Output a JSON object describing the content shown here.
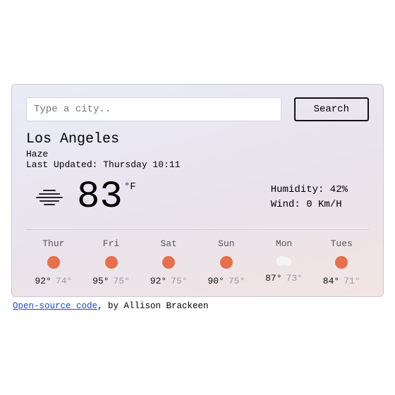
{
  "search": {
    "placeholder": "Type a city..",
    "button": "Search"
  },
  "location": {
    "city": "Los Angeles",
    "condition": "Haze",
    "updated": "Last Updated: Thursday 10:11"
  },
  "current": {
    "temp": "83",
    "unit": "°F",
    "humidity": "Humidity: 42%",
    "wind": "Wind: 0 Km/H"
  },
  "forecast": [
    {
      "day": "Thur",
      "icon": "sun",
      "hi": "92°",
      "lo": "74°"
    },
    {
      "day": "Fri",
      "icon": "sun",
      "hi": "95°",
      "lo": "75°"
    },
    {
      "day": "Sat",
      "icon": "sun",
      "hi": "92°",
      "lo": "75°"
    },
    {
      "day": "Sun",
      "icon": "sun",
      "hi": "90°",
      "lo": "75°"
    },
    {
      "day": "Mon",
      "icon": "cloud",
      "hi": "87°",
      "lo": "73°"
    },
    {
      "day": "Tues",
      "icon": "sun",
      "hi": "84°",
      "lo": "71°"
    }
  ],
  "footer": {
    "link": "Open-source code",
    "rest": ", by Allison Brackeen"
  }
}
